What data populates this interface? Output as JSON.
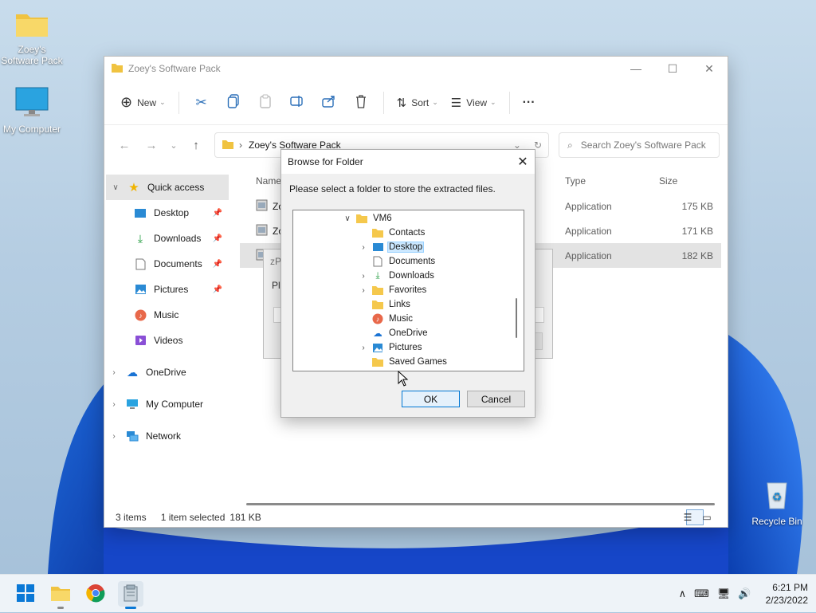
{
  "desktop": {
    "icons": [
      {
        "label": "Zoey's Software Pack"
      },
      {
        "label": "My Computer"
      },
      {
        "label": "Recycle Bin"
      }
    ]
  },
  "explorer": {
    "title": "Zoey's Software Pack",
    "controls": {
      "minimize": "—",
      "maximize": "☐",
      "close": "✕"
    },
    "toolbar": {
      "new": "New",
      "sort": "Sort",
      "view": "View",
      "more": "···"
    },
    "address": {
      "path": "Zoey's Software Pack",
      "search_placeholder": "Search Zoey's Software Pack"
    },
    "sidebar": {
      "quick_access": "Quick access",
      "items": [
        {
          "label": "Desktop"
        },
        {
          "label": "Downloads"
        },
        {
          "label": "Documents"
        },
        {
          "label": "Pictures"
        },
        {
          "label": "Music"
        },
        {
          "label": "Videos"
        }
      ],
      "onedrive": "OneDrive",
      "my_computer": "My Computer",
      "network": "Network"
    },
    "columns": {
      "name": "Name",
      "type": "Type",
      "size": "Size"
    },
    "rows": [
      {
        "name": "Zoey",
        "type": "Application",
        "size": "175 KB"
      },
      {
        "name": "Zoey",
        "type": "Application",
        "size": "171 KB"
      },
      {
        "name": "z",
        "type": "Application",
        "size": "182 KB"
      }
    ],
    "status": {
      "items": "3 items",
      "selected": "1 item selected",
      "size": "181 KB"
    }
  },
  "background_dialog": {
    "title": "zP",
    "text": "Ple"
  },
  "browse_dialog": {
    "title": "Browse for Folder",
    "close": "✕",
    "prompt": "Please select a folder to store the extracted files.",
    "tree": [
      {
        "label": "VM6"
      },
      {
        "label": "Contacts"
      },
      {
        "label": "Desktop"
      },
      {
        "label": "Documents"
      },
      {
        "label": "Downloads"
      },
      {
        "label": "Favorites"
      },
      {
        "label": "Links"
      },
      {
        "label": "Music"
      },
      {
        "label": "OneDrive"
      },
      {
        "label": "Pictures"
      },
      {
        "label": "Saved Games"
      }
    ],
    "ok": "OK",
    "cancel": "Cancel"
  },
  "taskbar": {
    "time": "6:21 PM",
    "date": "2/23/2022"
  }
}
